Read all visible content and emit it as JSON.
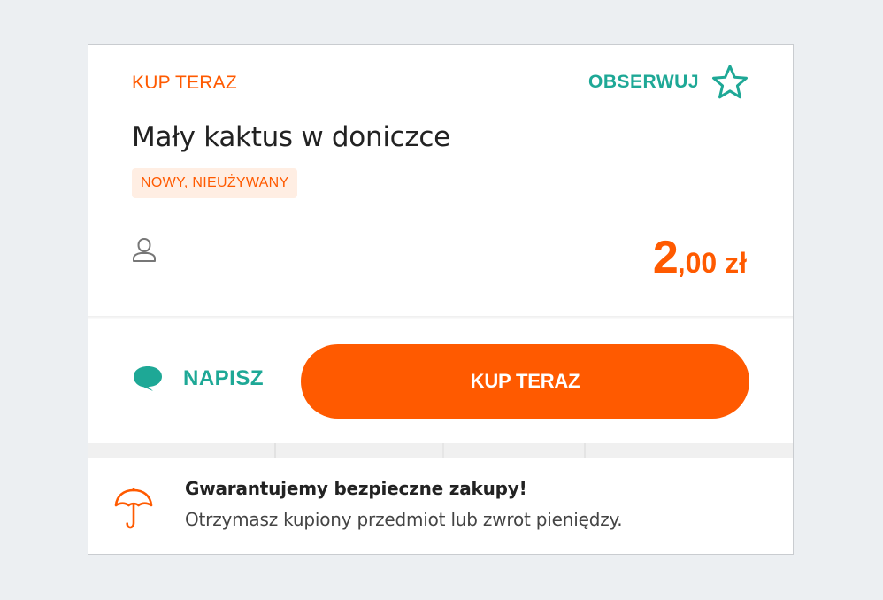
{
  "offer": {
    "type_label": "KUP TERAZ",
    "watch_label": "OBSERWUJ",
    "watch_icon": "star-outline-icon",
    "title": "Mały kaktus w doniczce",
    "condition": "NOWY, NIEUŻYWANY",
    "seller_icon": "user-outline-icon",
    "price": {
      "integer": "2",
      "decimal": ",00",
      "currency": " zł"
    }
  },
  "actions": {
    "message_icon": "speech-bubble-icon",
    "message_label": "NAPISZ",
    "buy_label": "KUP TERAZ"
  },
  "guarantee": {
    "icon": "umbrella-icon",
    "title": "Gwarantujemy bezpieczne zakupy!",
    "text": "Otrzymasz kupiony przedmiot lub zwrot pieniędzy."
  },
  "colors": {
    "accent": "#ff5a00",
    "teal": "#1ea896",
    "badge_bg": "#ffeee3",
    "page_bg": "#eceff2"
  }
}
